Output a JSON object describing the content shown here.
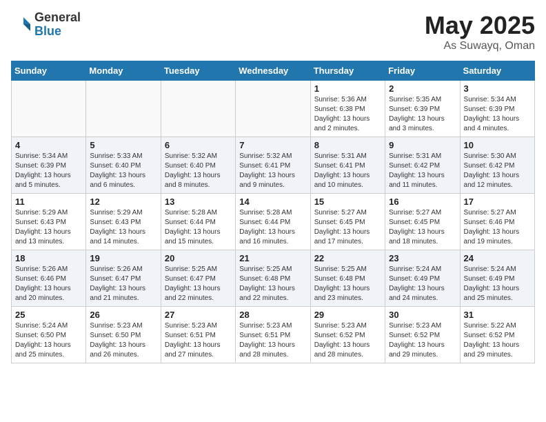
{
  "header": {
    "logo_general": "General",
    "logo_blue": "Blue",
    "title": "May 2025",
    "location": "As Suwayq, Oman"
  },
  "days_of_week": [
    "Sunday",
    "Monday",
    "Tuesday",
    "Wednesday",
    "Thursday",
    "Friday",
    "Saturday"
  ],
  "weeks": [
    [
      {
        "day": "",
        "info": ""
      },
      {
        "day": "",
        "info": ""
      },
      {
        "day": "",
        "info": ""
      },
      {
        "day": "",
        "info": ""
      },
      {
        "day": "1",
        "info": "Sunrise: 5:36 AM\nSunset: 6:38 PM\nDaylight: 13 hours\nand 2 minutes."
      },
      {
        "day": "2",
        "info": "Sunrise: 5:35 AM\nSunset: 6:39 PM\nDaylight: 13 hours\nand 3 minutes."
      },
      {
        "day": "3",
        "info": "Sunrise: 5:34 AM\nSunset: 6:39 PM\nDaylight: 13 hours\nand 4 minutes."
      }
    ],
    [
      {
        "day": "4",
        "info": "Sunrise: 5:34 AM\nSunset: 6:39 PM\nDaylight: 13 hours\nand 5 minutes."
      },
      {
        "day": "5",
        "info": "Sunrise: 5:33 AM\nSunset: 6:40 PM\nDaylight: 13 hours\nand 6 minutes."
      },
      {
        "day": "6",
        "info": "Sunrise: 5:32 AM\nSunset: 6:40 PM\nDaylight: 13 hours\nand 8 minutes."
      },
      {
        "day": "7",
        "info": "Sunrise: 5:32 AM\nSunset: 6:41 PM\nDaylight: 13 hours\nand 9 minutes."
      },
      {
        "day": "8",
        "info": "Sunrise: 5:31 AM\nSunset: 6:41 PM\nDaylight: 13 hours\nand 10 minutes."
      },
      {
        "day": "9",
        "info": "Sunrise: 5:31 AM\nSunset: 6:42 PM\nDaylight: 13 hours\nand 11 minutes."
      },
      {
        "day": "10",
        "info": "Sunrise: 5:30 AM\nSunset: 6:42 PM\nDaylight: 13 hours\nand 12 minutes."
      }
    ],
    [
      {
        "day": "11",
        "info": "Sunrise: 5:29 AM\nSunset: 6:43 PM\nDaylight: 13 hours\nand 13 minutes."
      },
      {
        "day": "12",
        "info": "Sunrise: 5:29 AM\nSunset: 6:43 PM\nDaylight: 13 hours\nand 14 minutes."
      },
      {
        "day": "13",
        "info": "Sunrise: 5:28 AM\nSunset: 6:44 PM\nDaylight: 13 hours\nand 15 minutes."
      },
      {
        "day": "14",
        "info": "Sunrise: 5:28 AM\nSunset: 6:44 PM\nDaylight: 13 hours\nand 16 minutes."
      },
      {
        "day": "15",
        "info": "Sunrise: 5:27 AM\nSunset: 6:45 PM\nDaylight: 13 hours\nand 17 minutes."
      },
      {
        "day": "16",
        "info": "Sunrise: 5:27 AM\nSunset: 6:45 PM\nDaylight: 13 hours\nand 18 minutes."
      },
      {
        "day": "17",
        "info": "Sunrise: 5:27 AM\nSunset: 6:46 PM\nDaylight: 13 hours\nand 19 minutes."
      }
    ],
    [
      {
        "day": "18",
        "info": "Sunrise: 5:26 AM\nSunset: 6:46 PM\nDaylight: 13 hours\nand 20 minutes."
      },
      {
        "day": "19",
        "info": "Sunrise: 5:26 AM\nSunset: 6:47 PM\nDaylight: 13 hours\nand 21 minutes."
      },
      {
        "day": "20",
        "info": "Sunrise: 5:25 AM\nSunset: 6:47 PM\nDaylight: 13 hours\nand 22 minutes."
      },
      {
        "day": "21",
        "info": "Sunrise: 5:25 AM\nSunset: 6:48 PM\nDaylight: 13 hours\nand 22 minutes."
      },
      {
        "day": "22",
        "info": "Sunrise: 5:25 AM\nSunset: 6:48 PM\nDaylight: 13 hours\nand 23 minutes."
      },
      {
        "day": "23",
        "info": "Sunrise: 5:24 AM\nSunset: 6:49 PM\nDaylight: 13 hours\nand 24 minutes."
      },
      {
        "day": "24",
        "info": "Sunrise: 5:24 AM\nSunset: 6:49 PM\nDaylight: 13 hours\nand 25 minutes."
      }
    ],
    [
      {
        "day": "25",
        "info": "Sunrise: 5:24 AM\nSunset: 6:50 PM\nDaylight: 13 hours\nand 25 minutes."
      },
      {
        "day": "26",
        "info": "Sunrise: 5:23 AM\nSunset: 6:50 PM\nDaylight: 13 hours\nand 26 minutes."
      },
      {
        "day": "27",
        "info": "Sunrise: 5:23 AM\nSunset: 6:51 PM\nDaylight: 13 hours\nand 27 minutes."
      },
      {
        "day": "28",
        "info": "Sunrise: 5:23 AM\nSunset: 6:51 PM\nDaylight: 13 hours\nand 28 minutes."
      },
      {
        "day": "29",
        "info": "Sunrise: 5:23 AM\nSunset: 6:52 PM\nDaylight: 13 hours\nand 28 minutes."
      },
      {
        "day": "30",
        "info": "Sunrise: 5:23 AM\nSunset: 6:52 PM\nDaylight: 13 hours\nand 29 minutes."
      },
      {
        "day": "31",
        "info": "Sunrise: 5:22 AM\nSunset: 6:52 PM\nDaylight: 13 hours\nand 29 minutes."
      }
    ]
  ]
}
